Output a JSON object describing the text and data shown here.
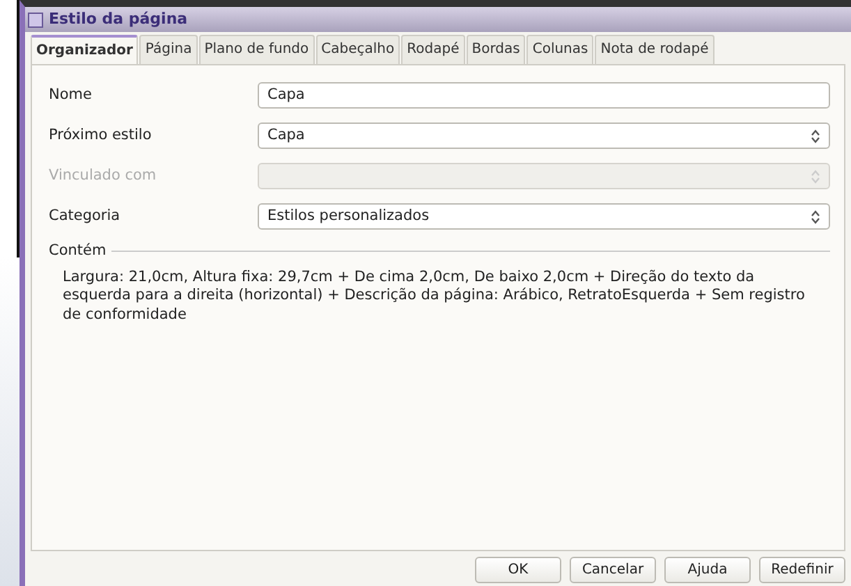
{
  "window": {
    "title": "Estilo da página"
  },
  "tabs": [
    {
      "label": "Organizador",
      "selected": true
    },
    {
      "label": "Página",
      "selected": false
    },
    {
      "label": "Plano de fundo",
      "selected": false
    },
    {
      "label": "Cabeçalho",
      "selected": false
    },
    {
      "label": "Rodapé",
      "selected": false
    },
    {
      "label": "Bordas",
      "selected": false
    },
    {
      "label": "Colunas",
      "selected": false
    },
    {
      "label": "Nota de rodapé",
      "selected": false
    }
  ],
  "fields": [
    {
      "label": "Nome",
      "kind": "text",
      "value": "Capa",
      "disabled": false
    },
    {
      "label": "Próximo estilo",
      "kind": "select",
      "value": "Capa",
      "disabled": false
    },
    {
      "label": "Vinculado com",
      "kind": "select",
      "disabled": true
    },
    {
      "label": "Categoria",
      "kind": "select",
      "value": "Estilos personalizados",
      "disabled": false
    }
  ],
  "contains": {
    "title": "Contém",
    "text": "Largura: 21,0cm, Altura fixa: 29,7cm + De cima 2,0cm, De baixo 2,0cm + Direção do texto da esquerda para a direita (horizontal) + Descrição da página: Arábico, RetratoEsquerda + Sem registro de conformidade"
  },
  "buttons": [
    "OK",
    "Cancelar",
    "Ajuda",
    "Redefinir"
  ]
}
